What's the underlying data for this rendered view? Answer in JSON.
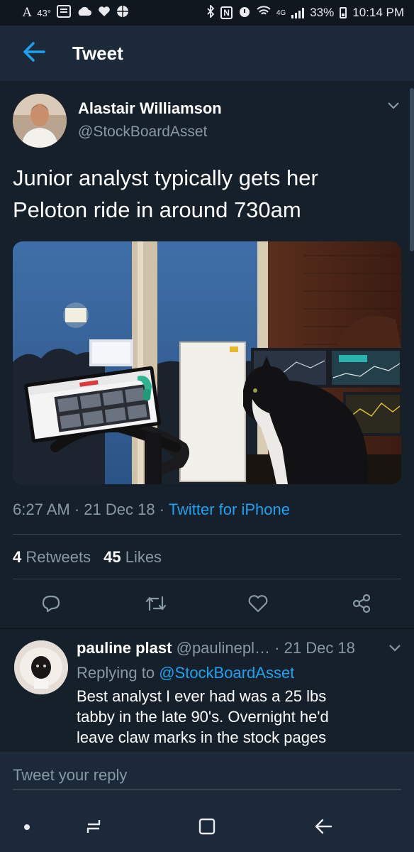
{
  "status_bar": {
    "temperature": "43°",
    "battery_percent": "33%",
    "time": "10:14 PM",
    "network": "4G",
    "icons": [
      "accessibility-icon",
      "weather-icon",
      "news-icon",
      "cloud-icon",
      "heart-icon",
      "basketball-icon",
      "bluetooth-icon",
      "nfc-icon",
      "alarm-icon",
      "wifi-icon",
      "signal-icon",
      "battery-icon"
    ]
  },
  "header": {
    "title": "Tweet",
    "back_icon": "arrow-left-icon"
  },
  "tweet": {
    "author_name": "Alastair Williamson",
    "author_handle": "@StockBoardAsset",
    "text_line1": "Junior analyst typically gets her",
    "text_line2": "Peloton ride in around 730am",
    "time": "6:27 AM",
    "date": "21 Dec 18",
    "source": "Twitter for iPhone",
    "retweets_count": "4",
    "retweets_label": "Retweets",
    "likes_count": "45",
    "likes_label": "Likes"
  },
  "actions": [
    "reply-icon",
    "retweet-icon",
    "like-icon",
    "share-icon"
  ],
  "reply": {
    "name": "pauline plast",
    "handle": "@paulinepl…",
    "date": "21 Dec 18",
    "replying_prefix": "Replying to",
    "replying_handle": "@StockBoardAsset",
    "line1": "Best analyst I ever had was a 25 lbs",
    "line2": "tabby in the late 90's.  Overnight he'd",
    "line3": "leave claw marks in the stock pages"
  },
  "compose": {
    "placeholder": "Tweet your reply"
  },
  "colors": {
    "background": "#15202b",
    "header": "#1c2938",
    "accent": "#1da1f2",
    "secondary_text": "#8899a6",
    "divider": "#38444d"
  }
}
